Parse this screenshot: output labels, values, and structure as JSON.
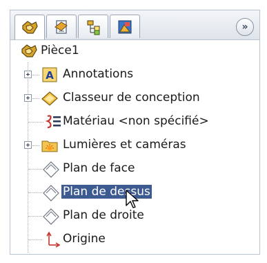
{
  "tabs": [
    {
      "icon": "feature-manager-icon"
    },
    {
      "icon": "property-manager-icon"
    },
    {
      "icon": "configuration-manager-icon"
    },
    {
      "icon": "display-manager-icon"
    }
  ],
  "expand_label": "»",
  "tree": {
    "root": {
      "label": "Pièce1",
      "icon": "part-icon"
    },
    "items": [
      {
        "label": "Annotations",
        "icon": "annotations-icon",
        "expandable": true
      },
      {
        "label": "Classeur de conception",
        "icon": "design-binder-icon",
        "expandable": true
      },
      {
        "label": "Matériau <non spécifié>",
        "icon": "material-icon",
        "expandable": false
      },
      {
        "label": "Lumières et caméras",
        "icon": "lights-cameras-icon",
        "expandable": true
      },
      {
        "label": "Plan de face",
        "icon": "plane-icon",
        "expandable": false
      },
      {
        "label": "Plan de dessus",
        "icon": "plane-icon",
        "expandable": false,
        "selected": true
      },
      {
        "label": "Plan de droite",
        "icon": "plane-icon",
        "expandable": false
      },
      {
        "label": "Origine",
        "icon": "origin-icon",
        "expandable": false
      }
    ]
  },
  "colors": {
    "selection": "#3d5a91"
  }
}
